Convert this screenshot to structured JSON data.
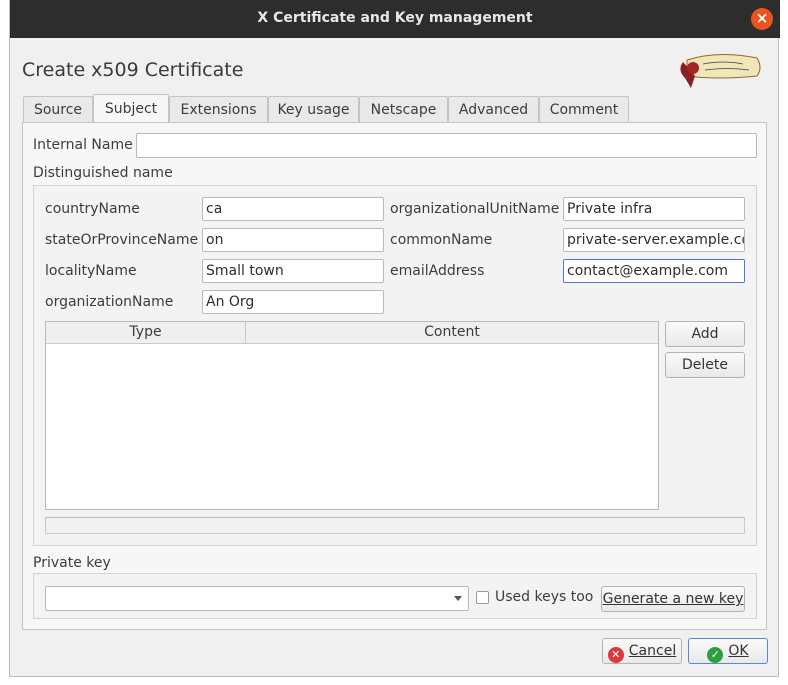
{
  "window": {
    "title": "X Certificate and Key management",
    "close_glyph": "×"
  },
  "dialog": {
    "heading": "Create x509 Certificate"
  },
  "tabs": [
    {
      "label": "Source"
    },
    {
      "label": "Subject"
    },
    {
      "label": "Extensions"
    },
    {
      "label": "Key usage"
    },
    {
      "label": "Netscape"
    },
    {
      "label": "Advanced"
    },
    {
      "label": "Comment"
    }
  ],
  "active_tab": "Subject",
  "subject": {
    "internal_name_label": "Internal Name",
    "internal_name_value": "",
    "distinguished_name_label": "Distinguished name",
    "fields": {
      "countryName": {
        "label": "countryName",
        "value": "ca"
      },
      "stateOrProvinceName": {
        "label": "stateOrProvinceName",
        "value": "on"
      },
      "localityName": {
        "label": "localityName",
        "value": "Small town"
      },
      "organizationName": {
        "label": "organizationName",
        "value": "An Org"
      },
      "organizationalUnitName": {
        "label": "organizationalUnitName",
        "value": "Private infra"
      },
      "commonName": {
        "label": "commonName",
        "value": "private-server.example.com"
      },
      "emailAddress": {
        "label": "emailAddress",
        "value": "contact@example.com"
      }
    },
    "table": {
      "columns": [
        "Type",
        "Content"
      ],
      "rows": []
    },
    "add_label": "Add",
    "delete_label": "Delete"
  },
  "private_key": {
    "label": "Private key",
    "selected": "",
    "used_keys_label": "Used keys too",
    "used_keys_checked": false,
    "generate_label": "Generate a new key"
  },
  "footer": {
    "cancel_label": "Cancel",
    "ok_label": "OK"
  },
  "colors": {
    "titlebar": "#2d2d2d",
    "close": "#e95420",
    "cancel_icon": "#d93a3a",
    "ok_icon": "#2e9e3e",
    "focus": "#4a7cc7"
  }
}
